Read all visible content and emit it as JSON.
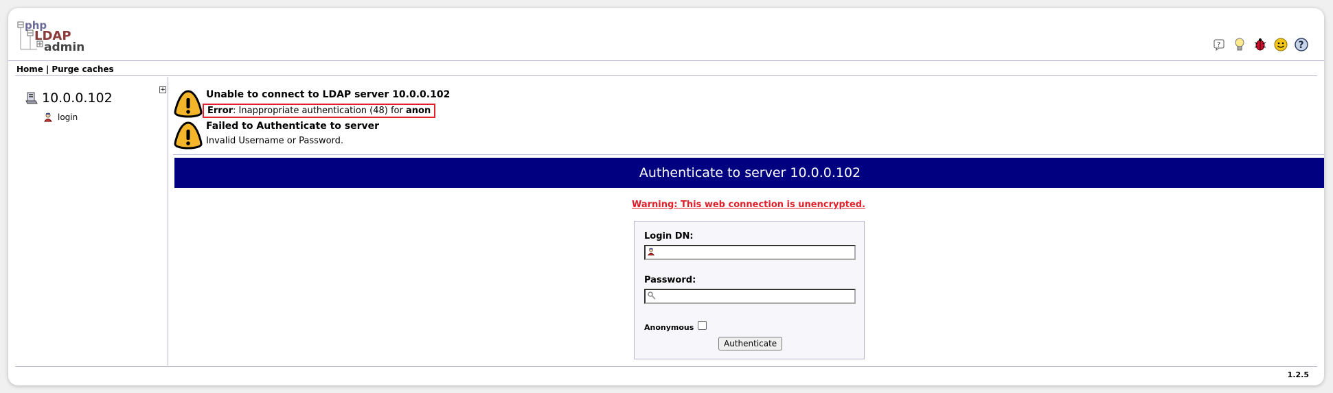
{
  "header": {
    "logo": {
      "line1": "php",
      "line2": "LDAP",
      "line3": "admin"
    },
    "icons": [
      "help-icon",
      "lightbulb-icon",
      "bug-icon",
      "donate-smiley-icon",
      "question-icon"
    ]
  },
  "menu": {
    "home": "Home",
    "separator": "|",
    "purge": "Purge caches"
  },
  "tree": {
    "server": "10.0.0.102",
    "login": "login"
  },
  "messages": [
    {
      "title": "Unable to connect to LDAP server 10.0.0.102",
      "error_label": "Error",
      "error_text": ": Inappropriate authentication (48) for ",
      "error_user": "anon"
    },
    {
      "title": "Failed to Authenticate to server",
      "detail": "Invalid Username or Password."
    }
  ],
  "login_panel": {
    "banner": "Authenticate to server 10.0.0.102",
    "warning": "Warning: This web connection is unencrypted.",
    "login_dn_label": "Login DN:",
    "login_dn_value": "",
    "password_label": "Password:",
    "password_value": "",
    "anonymous_label": "Anonymous",
    "anonymous_checked": false,
    "button": "Authenticate"
  },
  "footer": {
    "version": "1.2.5"
  },
  "colors": {
    "banner_bg": "#000080",
    "warning": "#e0202a",
    "divider": "#b5b7d2"
  }
}
